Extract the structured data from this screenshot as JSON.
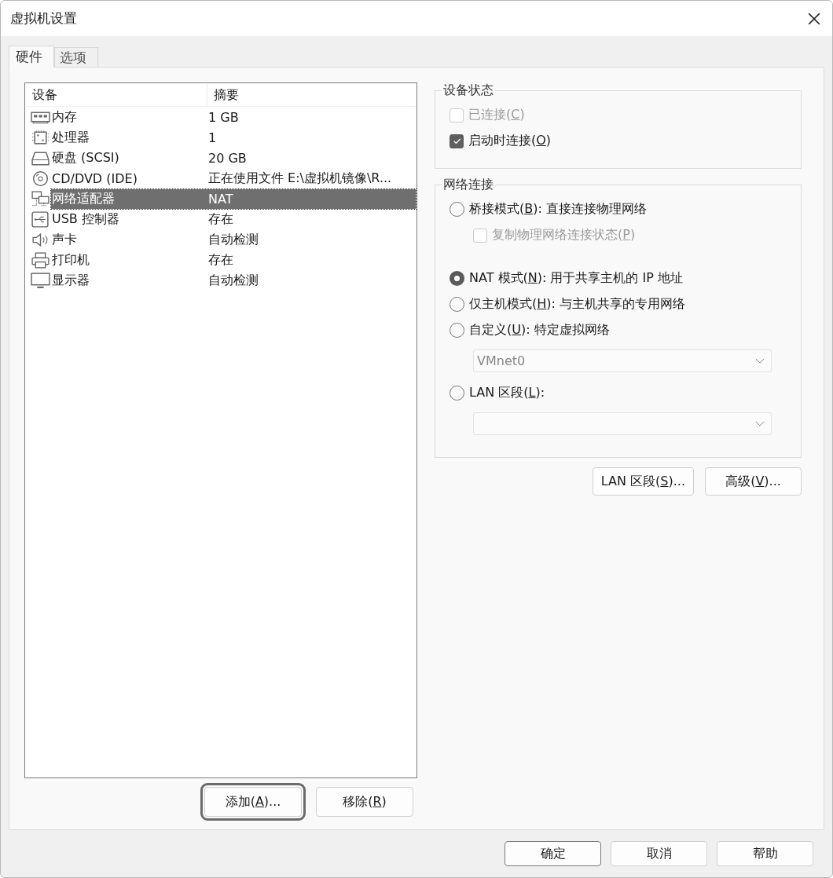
{
  "window": {
    "title": "虚拟机设置"
  },
  "tabs": [
    {
      "label": "硬件",
      "selected": true
    },
    {
      "label": "选项",
      "selected": false
    }
  ],
  "device_table": {
    "columns": [
      "设备",
      "摘要"
    ],
    "rows": [
      {
        "kind": "memory",
        "device": "内存",
        "summary": "1 GB",
        "selected": false
      },
      {
        "kind": "processor",
        "device": "处理器",
        "summary": "1",
        "selected": false
      },
      {
        "kind": "disk",
        "device": "硬盘 (SCSI)",
        "summary": "20 GB",
        "selected": false
      },
      {
        "kind": "cd",
        "device": "CD/DVD (IDE)",
        "summary": "正在使用文件 E:\\虚拟机镜像\\R...",
        "selected": false
      },
      {
        "kind": "network",
        "device": "网络适配器",
        "summary": "NAT",
        "selected": true
      },
      {
        "kind": "usb",
        "device": "USB 控制器",
        "summary": "存在",
        "selected": false
      },
      {
        "kind": "sound",
        "device": "声卡",
        "summary": "自动检测",
        "selected": false
      },
      {
        "kind": "printer",
        "device": "打印机",
        "summary": "存在",
        "selected": false
      },
      {
        "kind": "display",
        "device": "显示器",
        "summary": "自动检测",
        "selected": false
      }
    ]
  },
  "list_buttons": [
    {
      "prefix": "添加(",
      "access_key": "A",
      "suffix": ")...",
      "focused": true
    },
    {
      "prefix": "移除(",
      "access_key": "R",
      "suffix": ")",
      "focused": false
    }
  ],
  "device_status": {
    "title": "设备状态",
    "items": [
      {
        "kind": "checkbox",
        "prefix": "已连接(",
        "access_key": "C",
        "suffix": ")",
        "checked": false,
        "disabled": true
      },
      {
        "kind": "checkbox",
        "prefix": "启动时连接(",
        "access_key": "O",
        "suffix": ")",
        "checked": true
      }
    ]
  },
  "network_connection": {
    "title": "网络连接",
    "items": [
      {
        "kind": "radio",
        "prefix": "桥接模式(",
        "access_key": "B",
        "suffix": "): 直接连接物理网络",
        "selected": false
      },
      {
        "kind": "checkbox",
        "prefix": "复制物理网络连接状态(",
        "access_key": "P",
        "suffix": ")",
        "checked": false,
        "disabled": true
      },
      {
        "kind": "radio",
        "prefix": "NAT 模式(",
        "access_key": "N",
        "suffix": "): 用于共享主机的 IP 地址",
        "selected": true
      },
      {
        "kind": "radio",
        "prefix": "仅主机模式(",
        "access_key": "H",
        "suffix": "): 与主机共享的专用网络",
        "selected": false
      },
      {
        "kind": "radio",
        "prefix": "自定义(",
        "access_key": "U",
        "suffix": "): 特定虚拟网络",
        "selected": false
      },
      {
        "kind": "select",
        "value": "VMnet0",
        "disabled": true
      },
      {
        "kind": "radio",
        "prefix": "LAN 区段(",
        "access_key": "L",
        "suffix": "):",
        "selected": false
      },
      {
        "kind": "select",
        "disabled": true
      }
    ]
  },
  "network_buttons": [
    {
      "prefix": "LAN 区段(",
      "access_key": "S",
      "suffix": ")..."
    },
    {
      "prefix": "高级(",
      "access_key": "V",
      "suffix": ")..."
    }
  ],
  "dialog_buttons": [
    {
      "label": "确定",
      "default": true
    },
    {
      "label": "取消",
      "default": false
    },
    {
      "label": "帮助",
      "default": false
    }
  ]
}
